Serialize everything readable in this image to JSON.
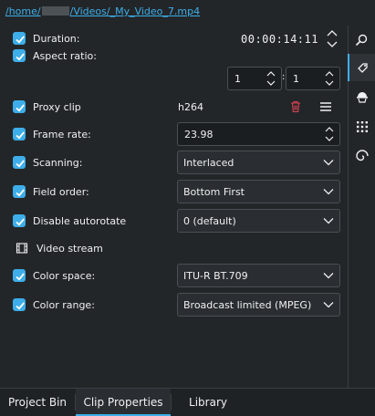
{
  "path": {
    "prefix": "/home/",
    "suffix": "/Videos/_My_Video_7.mp4"
  },
  "properties": {
    "duration": {
      "label": "Duration:",
      "checked": true,
      "value": "00:00:14:11"
    },
    "aspect_ratio": {
      "label": "Aspect ratio:",
      "checked": true,
      "num": "1",
      "den": "1",
      "separator": ":"
    },
    "proxy_clip": {
      "label": "Proxy clip",
      "checked": true,
      "value": "h264"
    },
    "frame_rate": {
      "label": "Frame rate:",
      "checked": true,
      "value": "23.98"
    },
    "scanning": {
      "label": "Scanning:",
      "checked": true,
      "value": "Interlaced"
    },
    "field_order": {
      "label": "Field order:",
      "checked": true,
      "value": "Bottom First"
    },
    "disable_autorotate": {
      "label": "Disable autorotate",
      "checked": true,
      "value": "0 (default)"
    },
    "video_stream": {
      "label": "Video stream"
    },
    "color_space": {
      "label": "Color space:",
      "checked": true,
      "value": "ITU-R BT.709"
    },
    "color_range": {
      "label": "Color range:",
      "checked": true,
      "value": "Broadcast limited (MPEG)"
    }
  },
  "sidebar": {
    "buttons": [
      "search-icon",
      "marker-icon",
      "audio-driver-icon",
      "grid-icon",
      "spiral-icon"
    ],
    "active": "marker-icon"
  },
  "tabs": [
    {
      "label": "Project Bin",
      "active": false
    },
    {
      "label": "Clip Properties",
      "active": true
    },
    {
      "label": "Library",
      "active": false
    }
  ],
  "colors": {
    "accent": "#3daee9",
    "background": "#232629",
    "danger": "#da4453"
  }
}
